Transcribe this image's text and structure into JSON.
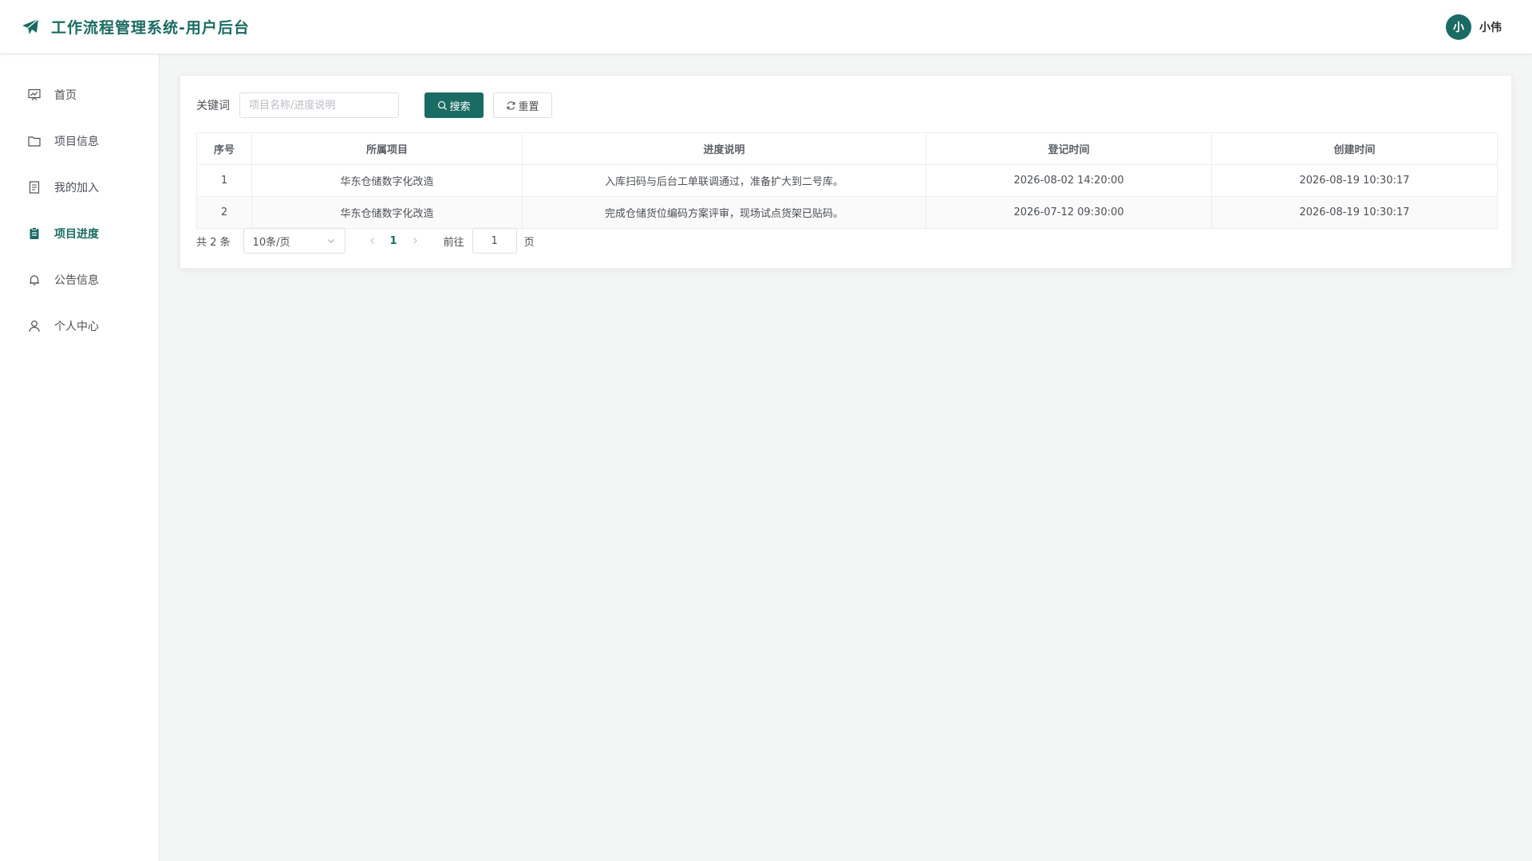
{
  "app": {
    "title": "工作流程管理系统-用户后台",
    "brand_icon": "paper-plane-icon",
    "accent_color": "#1a6b63"
  },
  "user": {
    "avatar_text": "小",
    "name": "小伟"
  },
  "sidebar": {
    "items": [
      {
        "label": "首页",
        "icon": "dashboard-icon",
        "active": false
      },
      {
        "label": "项目信息",
        "icon": "folder-icon",
        "active": false
      },
      {
        "label": "我的加入",
        "icon": "document-icon",
        "active": false
      },
      {
        "label": "项目进度",
        "icon": "clipboard-icon",
        "active": true
      },
      {
        "label": "公告信息",
        "icon": "bell-icon",
        "active": false
      },
      {
        "label": "个人中心",
        "icon": "user-icon",
        "active": false
      }
    ]
  },
  "search": {
    "label": "关键词",
    "value": "",
    "placeholder": "项目名称/进度说明",
    "search_button": "搜索",
    "reset_button": "重置"
  },
  "table": {
    "columns": [
      "序号",
      "所属项目",
      "进度说明",
      "登记时间",
      "创建时间"
    ],
    "rows": [
      [
        "1",
        "华东仓储数字化改造",
        "入库扫码与后台工单联调通过，准备扩大到二号库。",
        "2026-08-02 14:20:00",
        "2026-08-19 10:30:17"
      ],
      [
        "2",
        "华东仓储数字化改造",
        "完成仓储货位编码方案评审，现场试点货架已贴码。",
        "2026-07-12 09:30:00",
        "2026-08-19 10:30:17"
      ]
    ]
  },
  "pagination": {
    "total_text": "共 2 条",
    "page_size": "10条/页",
    "current_page": "1",
    "goto_label": "前往",
    "goto_value": "1",
    "goto_suffix": "页"
  }
}
